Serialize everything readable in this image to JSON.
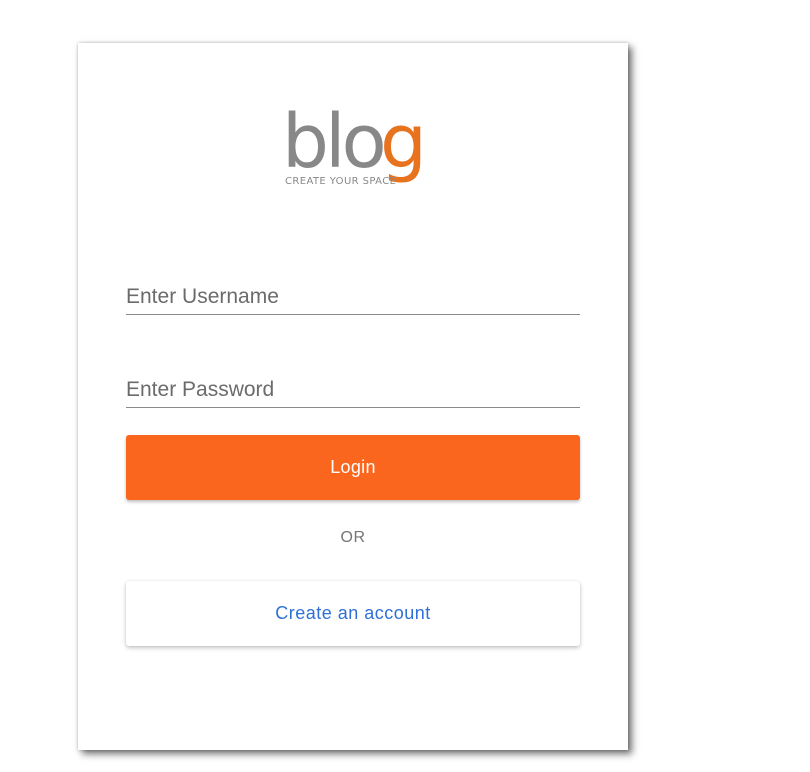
{
  "logo": {
    "wordmark_main": "blo",
    "wordmark_accent": "g",
    "tagline": "CREATE YOUR SPACE",
    "color_main": "#888888",
    "color_accent": "#e8731f"
  },
  "form": {
    "username_placeholder": "Enter Username",
    "username_value": "",
    "password_placeholder": "Enter Password",
    "password_value": "",
    "login_label": "Login",
    "separator": "OR",
    "create_account_label": "Create an account"
  },
  "colors": {
    "primary": "#fa661e",
    "link": "#2f6fd6"
  }
}
